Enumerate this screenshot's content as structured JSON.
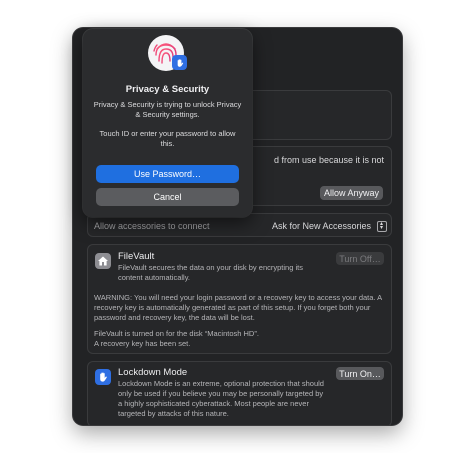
{
  "dialog": {
    "title": "Privacy & Security",
    "message": "Privacy & Security is trying to unlock Privacy & Security settings.",
    "hint": "Touch ID or enter your password to allow this.",
    "primary_button": "Use Password…",
    "cancel_button": "Cancel"
  },
  "blocked": {
    "text_line1": "d from use because it is not",
    "allow_button": "Allow Anyway"
  },
  "accessories": {
    "label": "Allow accessories to connect",
    "value": "Ask for New Accessories"
  },
  "filevault": {
    "title": "FileVault",
    "description": "FileVault secures the data on your disk by encrypting its content automatically.",
    "button": "Turn Off…",
    "warning": "WARNING: You will need your login password or a recovery key to access your data. A recovery key is automatically generated as part of this setup. If you forget both your password and recovery key, the data will be lost.",
    "status_line1": "FileVault is turned on for the disk “Macintosh HD”.",
    "status_line2": "A recovery key has been set."
  },
  "lockdown": {
    "title": "Lockdown Mode",
    "description": "Lockdown Mode is an extreme, optional protection that should only be used if you believe you may be personally targeted by a highly sophisticated cyberattack. Most people are never targeted by attacks of this nature.",
    "button": "Turn On…"
  },
  "colors": {
    "accent": "#1f6fe0",
    "window_bg": "#222325",
    "lockdown_icon": "#2f6fe3",
    "filevault_icon": "#8e8e93"
  }
}
